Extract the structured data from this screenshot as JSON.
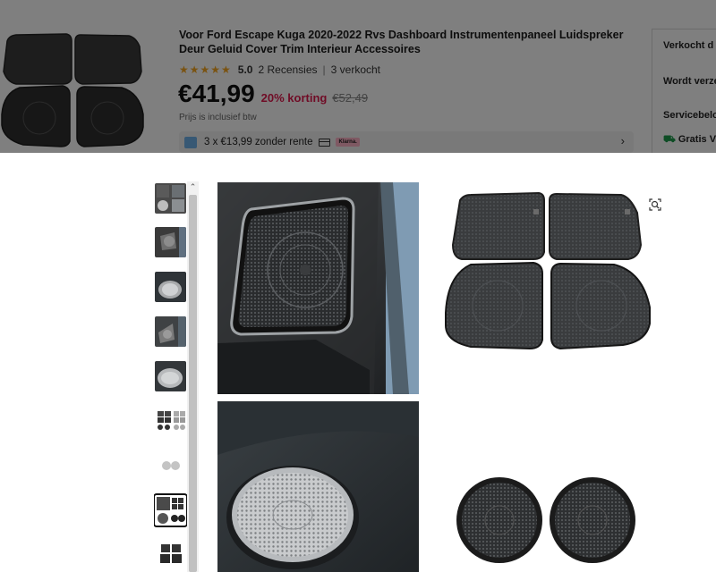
{
  "header": {
    "title": "Voor Ford Escape Kuga 2020-2022 Rvs Dashboard Instrumentenpaneel Luidspreker Deur Geluid Cover Trim Interieur Accessoires",
    "stars": "★★★★★",
    "rating": "5.0",
    "reviews": "2 Recensies",
    "separator": "|",
    "sold": "3 verkocht",
    "price": "€41,99",
    "discount": "20% korting",
    "old_price": "€52,49",
    "vat_note": "Prijs is inclusief btw",
    "installment": "3 x €13,99 zonder rente",
    "klarna_label": "Klarna.",
    "chevron": "›"
  },
  "side_panel": {
    "sold_by": "Verkocht d",
    "shipped": "Wordt verze",
    "service": "Servicebelo",
    "free": "Gratis V"
  },
  "gallery": {
    "thumbnail_count": 9,
    "selected_index": 7,
    "scroll_up": "⌃",
    "icon": "zoom-icon"
  },
  "colors": {
    "price_discount": "#e0184c",
    "stars": "#f5a623",
    "free_shipping": "#1d9a4a"
  }
}
